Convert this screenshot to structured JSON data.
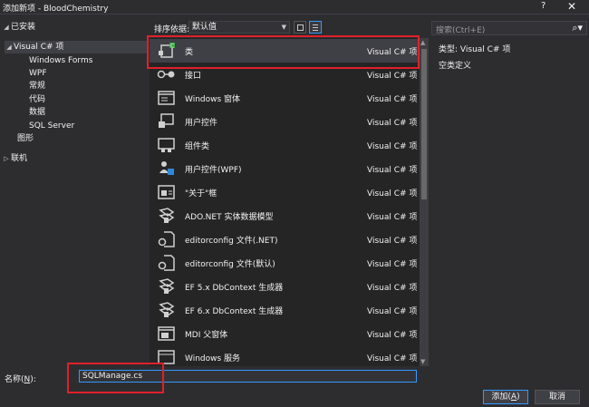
{
  "window": {
    "title": "添加新项 - BloodChemistry",
    "help": "?",
    "close": "✕"
  },
  "tree": {
    "installed": "已安装",
    "visual_cs": "Visual C# 项",
    "children": [
      "Windows Forms",
      "WPF",
      "常规",
      "代码",
      "数据",
      "SQL Server"
    ],
    "graphics": "图形",
    "online": "联机"
  },
  "toolbar": {
    "sort_label": "排序依据:",
    "sort_value": "默认值"
  },
  "search": {
    "placeholder": "搜索(Ctrl+E)"
  },
  "items": [
    {
      "name": "类",
      "lang": "Visual C# 项",
      "icon": "class-icon"
    },
    {
      "name": "接口",
      "lang": "Visual C# 项",
      "icon": "interface-icon"
    },
    {
      "name": "Windows 窗体",
      "lang": "Visual C# 项",
      "icon": "form-icon"
    },
    {
      "name": "用户控件",
      "lang": "Visual C# 项",
      "icon": "user-control-icon"
    },
    {
      "name": "组件类",
      "lang": "Visual C# 项",
      "icon": "component-icon"
    },
    {
      "name": "用户控件(WPF)",
      "lang": "Visual C# 项",
      "icon": "wpf-user-control-icon"
    },
    {
      "name": "\"关于\"框",
      "lang": "Visual C# 项",
      "icon": "about-box-icon"
    },
    {
      "name": "ADO.NET 实体数据模型",
      "lang": "Visual C# 项",
      "icon": "data-model-icon"
    },
    {
      "name": "editorconfig 文件(.NET)",
      "lang": "Visual C# 项",
      "icon": "config-file-icon"
    },
    {
      "name": "editorconfig 文件(默认)",
      "lang": "Visual C# 项",
      "icon": "config-file-icon"
    },
    {
      "name": "EF 5.x DbContext 生成器",
      "lang": "Visual C# 项",
      "icon": "dbcontext-icon"
    },
    {
      "name": "EF 6.x DbContext 生成器",
      "lang": "Visual C# 项",
      "icon": "dbcontext-icon"
    },
    {
      "name": "MDI 父窗体",
      "lang": "Visual C# 项",
      "icon": "mdi-form-icon"
    },
    {
      "name": "Windows 服务",
      "lang": "Visual C# 项",
      "icon": "service-icon"
    }
  ],
  "details": {
    "type_label": "类型:",
    "type_value": "Visual C# 项",
    "description": "空类定义"
  },
  "name_field": {
    "label_prefix": "名称(",
    "label_key": "N",
    "label_suffix": "):",
    "value": "SQLManage.cs"
  },
  "buttons": {
    "add_prefix": "添加(",
    "add_key": "A",
    "add_suffix": ")",
    "cancel": "取消"
  },
  "colors": {
    "accent": "#3399ff",
    "highlight_box": "#e0202a",
    "background": "#2d2d30",
    "list_bg": "#252526"
  }
}
